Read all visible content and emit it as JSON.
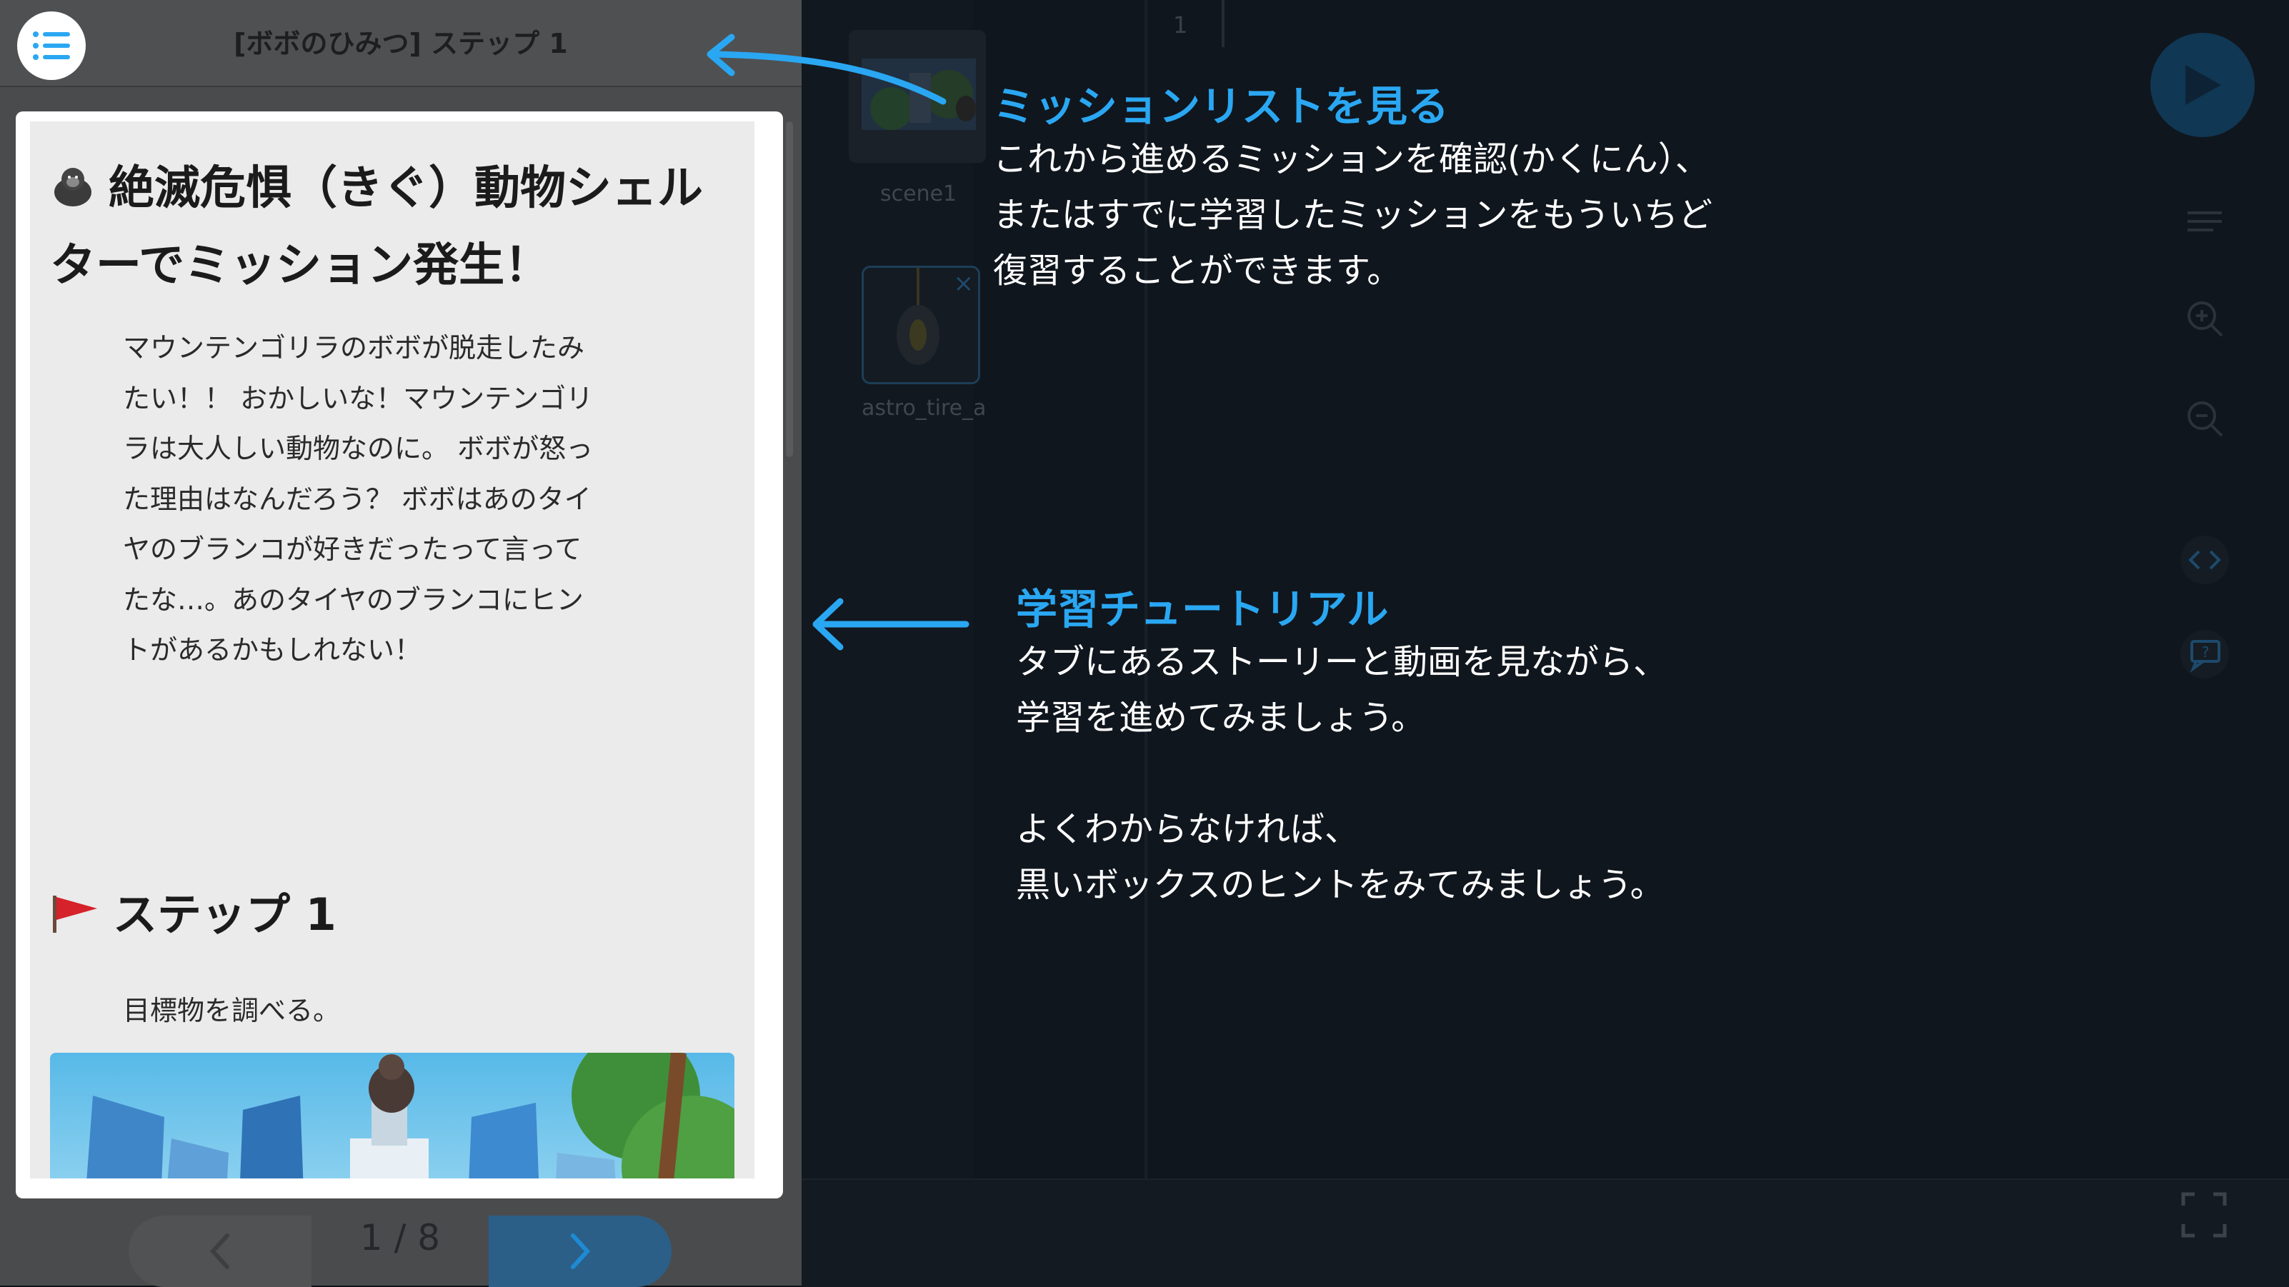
{
  "panel": {
    "title": "[ボボのひみつ] ステップ 1",
    "card_title": "絶滅危惧（きぐ）動物シェルターでミッション発生！",
    "story": "マウンテンゴリラのボボが脱走したみ\nたい！！ おかしいな！マウンテンゴリ\nラは大人しい動物なのに。 ボボが怒っ\nた理由はなんだろう？ ボボはあのタイ\nヤのブランコが好きだったって言って\nたな…。あのタイヤのブランコにヒン\nトがあるかもしれない！",
    "step_title": "ステップ 1",
    "step_text": "目標物を調べる。",
    "pager": "1 / 8"
  },
  "editor": {
    "line_number": "1",
    "sprites": [
      {
        "name": "scene1"
      },
      {
        "name": "astro_tire_a"
      }
    ]
  },
  "annotations": {
    "mission_title": "ミッションリストを見る",
    "mission_text": "これから進めるミッションを確認(かくにん）、\nまたはすでに学習したミッションをもういちど\n復習することができます。",
    "tutorial_title": "学習チュートリアル",
    "tutorial_text": "タブにあるストーリーと動画を見ながら、\n学習を進めてみましょう。\n\nよくわからなければ、\n黒いボックスのヒントをみてみましょう。"
  },
  "colors": {
    "accent": "#2aa7f2",
    "panel_bg": "#4a4b4d",
    "editor_bg": "#10161d"
  },
  "icons": [
    "list-icon",
    "gorilla-icon",
    "flag-icon",
    "chevron-left-icon",
    "chevron-right-icon",
    "play-icon",
    "zoom-in-icon",
    "zoom-out-icon",
    "code-icon",
    "help-icon",
    "fullscreen-icon"
  ]
}
